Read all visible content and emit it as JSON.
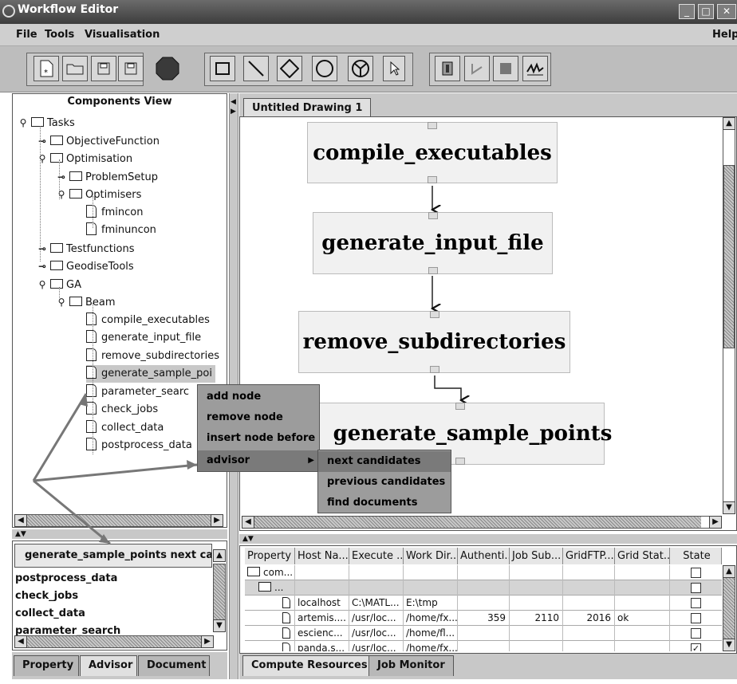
{
  "window": {
    "title": "Workflow Editor"
  },
  "menubar": {
    "file": "File",
    "tools": "Tools",
    "visualisation": "Visualisation",
    "help": "Help"
  },
  "components_view": {
    "title": "Components View",
    "tree": [
      {
        "label": "Tasks",
        "kind": "folder",
        "toggle": "open"
      },
      {
        "label": "ObjectiveFunction",
        "kind": "folder",
        "toggle": "closed"
      },
      {
        "label": "Optimisation",
        "kind": "folder",
        "toggle": "open"
      },
      {
        "label": "ProblemSetup",
        "kind": "folder",
        "toggle": "closed"
      },
      {
        "label": "Optimisers",
        "kind": "folder",
        "toggle": "open"
      },
      {
        "label": "fmincon",
        "kind": "doc"
      },
      {
        "label": "fminuncon",
        "kind": "doc"
      },
      {
        "label": "Testfunctions",
        "kind": "folder",
        "toggle": "closed"
      },
      {
        "label": "GeodiseTools",
        "kind": "folder",
        "toggle": "closed"
      },
      {
        "label": "GA",
        "kind": "folder",
        "toggle": "open"
      },
      {
        "label": "Beam",
        "kind": "folder",
        "toggle": "open"
      },
      {
        "label": "compile_executables",
        "kind": "doc"
      },
      {
        "label": "generate_input_file",
        "kind": "doc"
      },
      {
        "label": "remove_subdirectories",
        "kind": "doc"
      },
      {
        "label": "generate_sample_poi",
        "kind": "doc"
      },
      {
        "label": "parameter_searc",
        "kind": "doc"
      },
      {
        "label": "check_jobs",
        "kind": "doc"
      },
      {
        "label": "collect_data",
        "kind": "doc"
      },
      {
        "label": "postprocess_data",
        "kind": "doc"
      }
    ]
  },
  "context_menu": {
    "items": [
      "add node",
      "remove node",
      "insert node before",
      "advisor"
    ],
    "submenu": [
      "next candidates",
      "previous candidates",
      "find documents"
    ]
  },
  "drawing": {
    "tab": "Untitled Drawing 1",
    "nodes": [
      "compile_executables",
      "generate_input_file",
      "remove_subdirectories",
      "generate_sample_points"
    ]
  },
  "advisor": {
    "header": "generate_sample_points next cand",
    "items": [
      "postprocess_data",
      "check_jobs",
      "collect_data",
      "parameter_search"
    ],
    "tabs": [
      "Property",
      "Advisor",
      "Document"
    ]
  },
  "resources": {
    "columns": [
      "Property",
      "Host Na...",
      "Execute ...",
      "Work Dir...",
      "Authenti...",
      "Job Sub...",
      "GridFTP...",
      "Grid Stat...",
      "State"
    ],
    "rows": [
      {
        "property": "com...",
        "host": "",
        "exec": "",
        "work": "",
        "auth": "",
        "job": "",
        "ftp": "",
        "grid": "",
        "state": false
      },
      {
        "property": "...",
        "host": "",
        "exec": "",
        "work": "",
        "auth": "",
        "job": "",
        "ftp": "",
        "grid": "",
        "state": false
      },
      {
        "property": "",
        "host": "localhost",
        "exec": "C:\\MATL...",
        "work": "E:\\tmp",
        "auth": "",
        "job": "",
        "ftp": "",
        "grid": "",
        "state": false
      },
      {
        "property": "",
        "host": "artemis....",
        "exec": "/usr/loc...",
        "work": "/home/fx...",
        "auth": "359",
        "job": "2110",
        "ftp": "2016",
        "grid": "ok",
        "state": false
      },
      {
        "property": "",
        "host": "escienc...",
        "exec": "/usr/loc...",
        "work": "/home/fl...",
        "auth": "",
        "job": "",
        "ftp": "",
        "grid": "",
        "state": false
      },
      {
        "property": "",
        "host": "panda.s...",
        "exec": "/usr/loc...",
        "work": "/home/fx...",
        "auth": "",
        "job": "",
        "ftp": "",
        "grid": "",
        "state": true
      }
    ],
    "tabs": [
      "Compute Resources",
      "Job Monitor"
    ]
  }
}
